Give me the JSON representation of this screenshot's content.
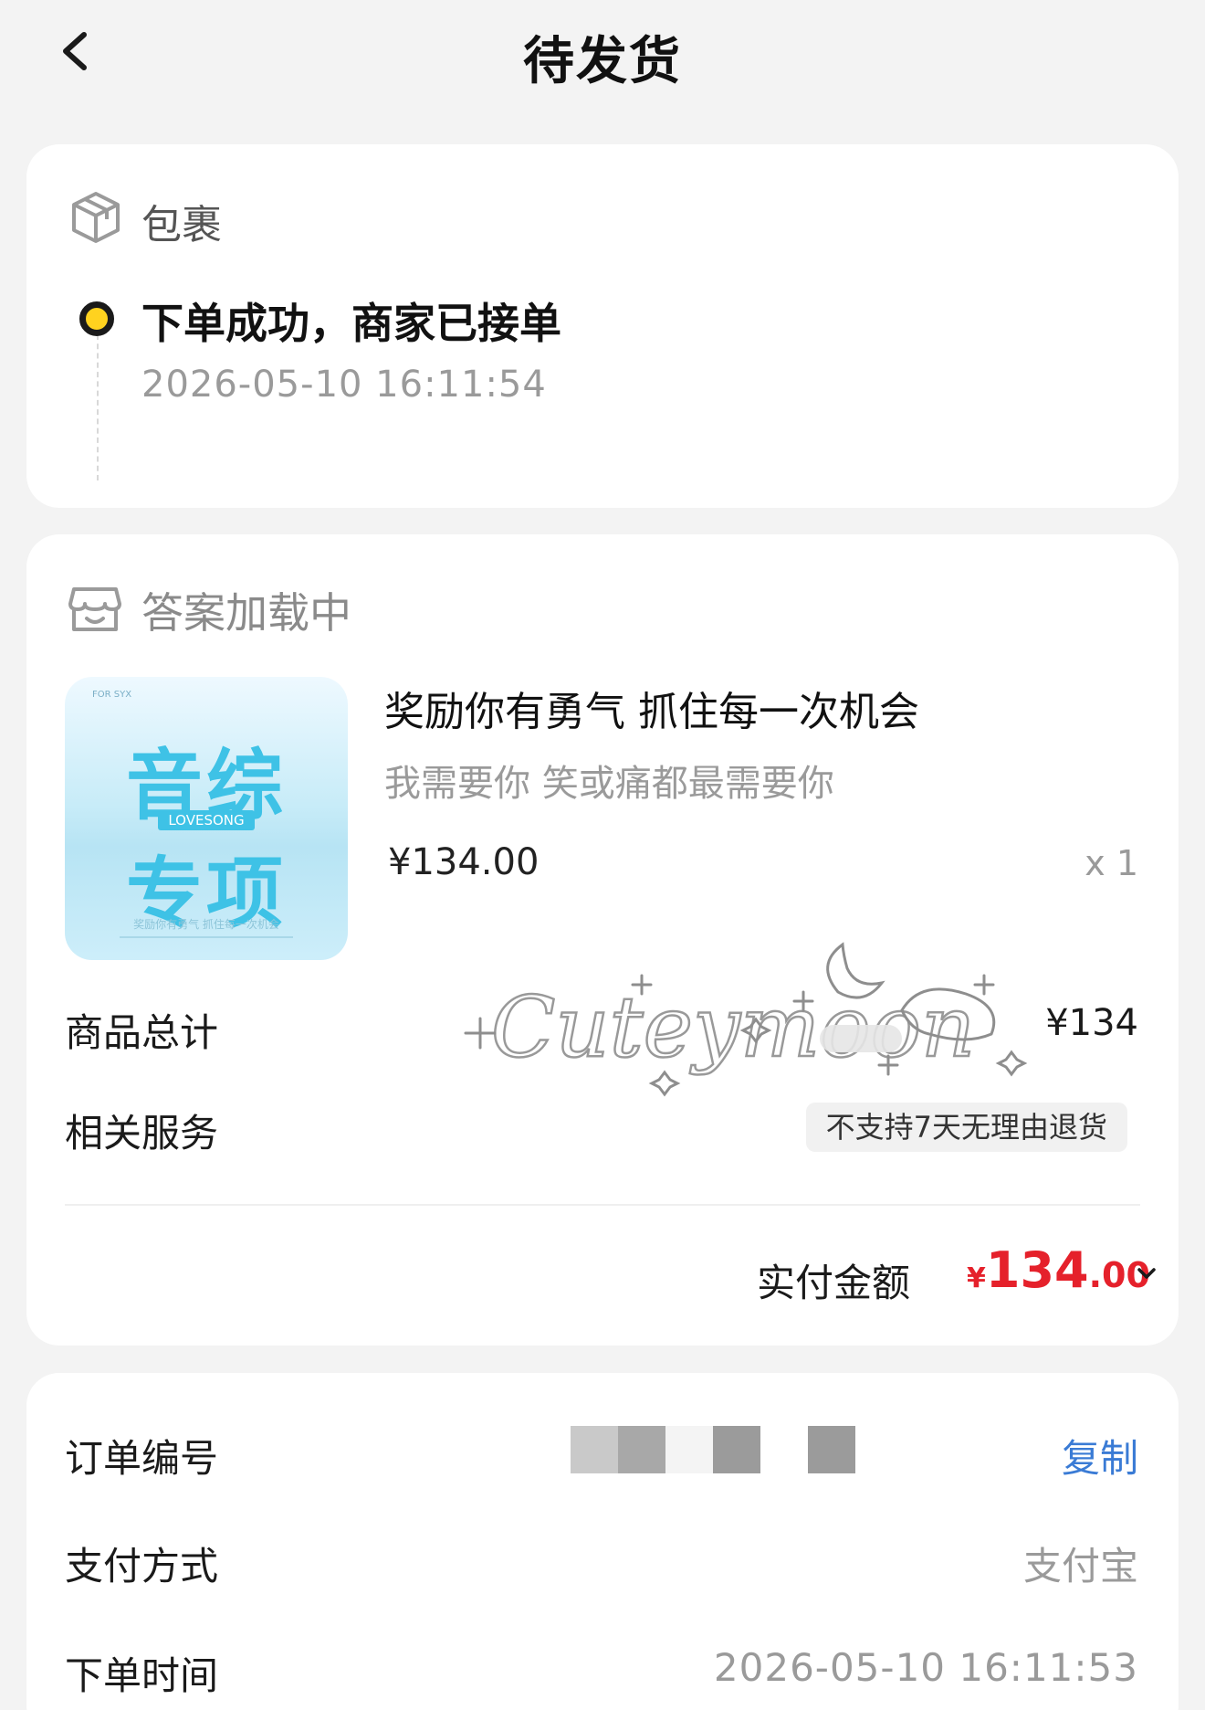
{
  "header": {
    "title": "待发货"
  },
  "package": {
    "label": "包裹",
    "status": "下单成功，商家已接单",
    "time": "2026-05-10 16:11:54"
  },
  "shop": {
    "name": "答案加载中"
  },
  "product": {
    "title": "奖励你有勇气 抓住每一次机会",
    "subtitle": "我需要你 笑或痛都最需要你",
    "price": "¥134.00",
    "quantity": "x 1",
    "thumbnail": {
      "top_text": "FOR SYX",
      "line1": "音综",
      "tag": "LOVESONG",
      "line2": "专项",
      "bottom_text": "奖励你有勇气 抓住每一次机会"
    }
  },
  "summary": {
    "subtotal_label": "商品总计",
    "subtotal_value": "¥134",
    "service_label": "相关服务",
    "service_tag": "不支持7天无理由退货",
    "paid_label": "实付金额",
    "paid_currency": "¥",
    "paid_integer": "134",
    "paid_decimal": ".00"
  },
  "watermark": {
    "text": "Cuteymoon"
  },
  "order": {
    "number_label": "订单编号",
    "copy_label": "复制",
    "pay_method_label": "支付方式",
    "pay_method_value": "支付宝",
    "order_time_label": "下单时间",
    "order_time_value": "2026-05-10 16:11:53"
  },
  "colors": {
    "accent_red": "#e5212b",
    "status_dot": "#ffd21f",
    "link_blue": "#3a7bd5",
    "thumbnail_cyan": "#3ec2e6"
  },
  "icons": [
    "back-arrow-icon",
    "package-box-icon",
    "shop-icon",
    "chevron-down-icon"
  ]
}
